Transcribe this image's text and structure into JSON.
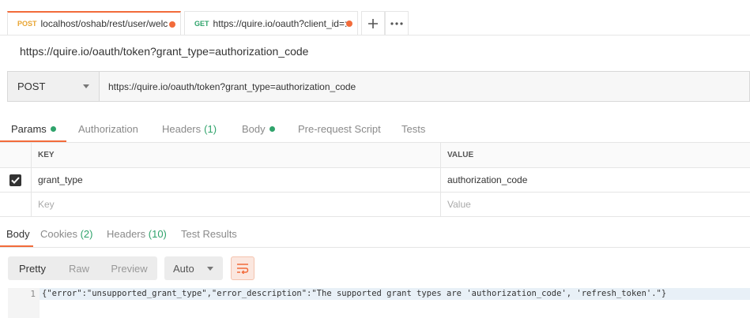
{
  "tabs": [
    {
      "method": "POST",
      "url": "localhost/oshab/rest/user/welc",
      "unsaved": true
    },
    {
      "method": "GET",
      "url": "https://quire.io/oauth?client_id=:",
      "unsaved": true
    }
  ],
  "tab_actions": {
    "new_tab_icon": "plus-icon",
    "more_icon": "ellipsis-icon"
  },
  "request_title": "https://quire.io/oauth/token?grant_type=authorization_code",
  "request": {
    "method": "POST",
    "url": "https://quire.io/oauth/token?grant_type=authorization_code"
  },
  "request_tabs": [
    {
      "label": "Params",
      "indicator": "green-dot",
      "active": true
    },
    {
      "label": "Authorization"
    },
    {
      "label": "Headers",
      "count": "(1)"
    },
    {
      "label": "Body",
      "indicator": "green-dot"
    },
    {
      "label": "Pre-request Script"
    },
    {
      "label": "Tests"
    }
  ],
  "params_table": {
    "headers": [
      "KEY",
      "VALUE"
    ],
    "rows": [
      {
        "checked": true,
        "key": "grant_type",
        "value": "authorization_code"
      }
    ],
    "placeholder": {
      "key": "Key",
      "value": "Value"
    }
  },
  "response_tabs": [
    {
      "label": "Body",
      "active": true
    },
    {
      "label": "Cookies",
      "count": "(2)"
    },
    {
      "label": "Headers",
      "count": "(10)"
    },
    {
      "label": "Test Results"
    }
  ],
  "view_modes": [
    "Pretty",
    "Raw",
    "Preview"
  ],
  "active_view": "Pretty",
  "format": "Auto",
  "wrap_icon": "wrap-lines-icon",
  "response_body": {
    "line_number": "1",
    "text": "{\"error\":\"unsupported_grant_type\",\"error_description\":\"The supported grant types are 'authorization_code', 'refresh_token'.\"}"
  },
  "colors": {
    "accent": "#f26b3a",
    "post": "#e8a431",
    "get": "#2fa36b",
    "indicator": "#2fa36b"
  }
}
